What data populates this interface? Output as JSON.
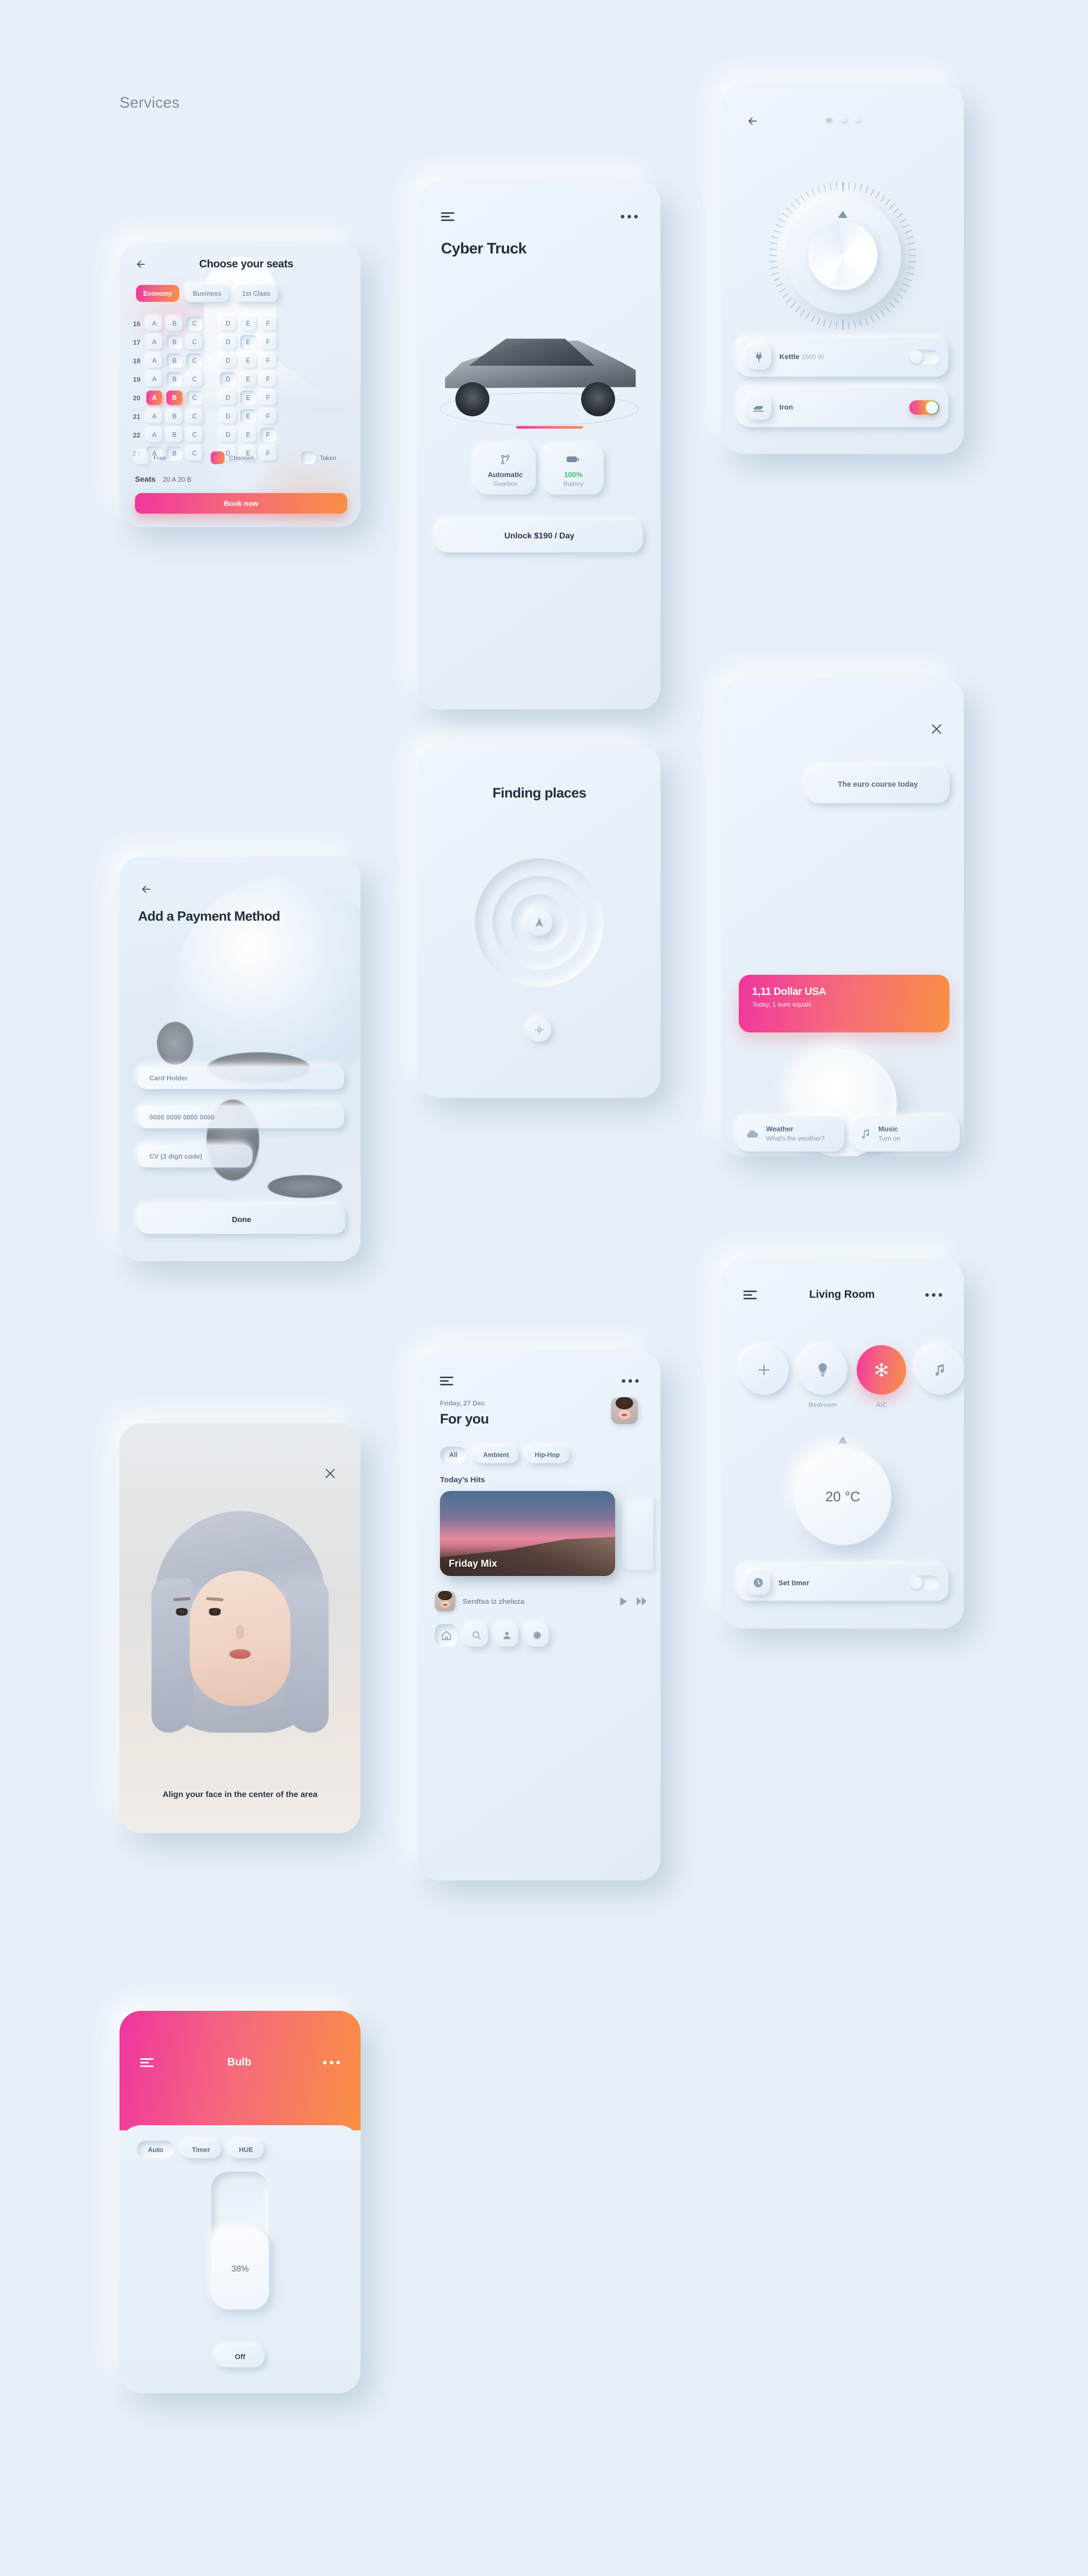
{
  "page": {
    "title": "Services",
    "background": "#e8f1fa",
    "accent_start": "#f0359f",
    "accent_end": "#f99143"
  },
  "seats_card": {
    "title": "Choose your seats",
    "classes": [
      {
        "label": "Economy",
        "active": true
      },
      {
        "label": "Business",
        "active": false
      },
      {
        "label": "1st Class",
        "active": false
      }
    ],
    "columns": [
      "A",
      "B",
      "C",
      "D",
      "E",
      "F"
    ],
    "rows": [
      {
        "number": "16",
        "seats": [
          {
            "label": "A",
            "state": "free"
          },
          {
            "label": "B",
            "state": "free"
          },
          {
            "label": "C",
            "state": "taken"
          },
          {
            "label": "D",
            "state": "free"
          },
          {
            "label": "E",
            "state": "free"
          },
          {
            "label": "F",
            "state": "free"
          }
        ]
      },
      {
        "number": "17",
        "seats": [
          {
            "label": "A",
            "state": "free"
          },
          {
            "label": "B",
            "state": "taken"
          },
          {
            "label": "C",
            "state": "free"
          },
          {
            "label": "D",
            "state": "free"
          },
          {
            "label": "E",
            "state": "taken"
          },
          {
            "label": "F",
            "state": "free"
          }
        ]
      },
      {
        "number": "18",
        "seats": [
          {
            "label": "A",
            "state": "free"
          },
          {
            "label": "B",
            "state": "taken"
          },
          {
            "label": "C",
            "state": "taken"
          },
          {
            "label": "D",
            "state": "free"
          },
          {
            "label": "E",
            "state": "free"
          },
          {
            "label": "F",
            "state": "free"
          }
        ]
      },
      {
        "number": "19",
        "seats": [
          {
            "label": "A",
            "state": "free"
          },
          {
            "label": "B",
            "state": "taken"
          },
          {
            "label": "C",
            "state": "free"
          },
          {
            "label": "D",
            "state": "taken"
          },
          {
            "label": "E",
            "state": "free"
          },
          {
            "label": "F",
            "state": "free"
          }
        ]
      },
      {
        "number": "20",
        "seats": [
          {
            "label": "A",
            "state": "chosen"
          },
          {
            "label": "B",
            "state": "chosen"
          },
          {
            "label": "C",
            "state": "taken"
          },
          {
            "label": "D",
            "state": "free"
          },
          {
            "label": "E",
            "state": "taken"
          },
          {
            "label": "F",
            "state": "free"
          }
        ]
      },
      {
        "number": "21",
        "seats": [
          {
            "label": "A",
            "state": "free"
          },
          {
            "label": "B",
            "state": "free"
          },
          {
            "label": "C",
            "state": "free"
          },
          {
            "label": "D",
            "state": "free"
          },
          {
            "label": "E",
            "state": "taken"
          },
          {
            "label": "F",
            "state": "free"
          }
        ]
      },
      {
        "number": "22",
        "seats": [
          {
            "label": "A",
            "state": "free"
          },
          {
            "label": "B",
            "state": "free"
          },
          {
            "label": "C",
            "state": "free"
          },
          {
            "label": "D",
            "state": "free"
          },
          {
            "label": "E",
            "state": "free"
          },
          {
            "label": "F",
            "state": "taken"
          }
        ]
      },
      {
        "number": "23",
        "seats": [
          {
            "label": "A",
            "state": "taken"
          },
          {
            "label": "B",
            "state": "taken"
          },
          {
            "label": "C",
            "state": "free"
          },
          {
            "label": "D",
            "state": "free"
          },
          {
            "label": "E",
            "state": "free"
          },
          {
            "label": "F",
            "state": "free"
          }
        ]
      }
    ],
    "legend": [
      {
        "label": "Free",
        "state": "free"
      },
      {
        "label": "Choosen",
        "state": "chosen"
      },
      {
        "label": "Taken",
        "state": "taken"
      }
    ],
    "summary_label": "Seats",
    "summary_value": "20 A  20 B",
    "book_button": "Book now"
  },
  "truck_card": {
    "title": "Cyber Truck",
    "specs": [
      {
        "icon": "gearbox-icon",
        "value": "Automatic",
        "sub": "Gearbox",
        "value_color": "#4a5768"
      },
      {
        "icon": "battery-icon",
        "value": "100%",
        "sub": "Battery",
        "value_color": "#38c172"
      }
    ],
    "unlock_button": "Unlock $190 / Day"
  },
  "places_card": {
    "title": "Finding places"
  },
  "music_card": {
    "date": "Friday, 27 Dec",
    "title": "For you",
    "genres": [
      {
        "label": "All",
        "active": true
      },
      {
        "label": "Ambient",
        "active": false
      },
      {
        "label": "Hip-Hop",
        "active": false
      }
    ],
    "section_label": "Today's Hits",
    "featured": {
      "name": "Friday Mix"
    },
    "now_playing": {
      "title": "Serdtsa iz zheleza"
    },
    "nav": [
      {
        "icon": "home-icon",
        "active": true
      },
      {
        "icon": "search-icon",
        "active": false
      },
      {
        "icon": "profile-icon",
        "active": false
      },
      {
        "icon": "gear-icon",
        "active": false
      }
    ]
  },
  "payment_card": {
    "title": "Add a Payment Method",
    "fields": [
      {
        "name": "card-holder",
        "placeholder": "Card Holder"
      },
      {
        "name": "card-number",
        "placeholder": "0000 0000 0000 0000"
      },
      {
        "name": "cv-code",
        "placeholder": "CV (3 digit code)"
      }
    ],
    "done_button": "Done"
  },
  "face_card": {
    "caption": "Align your face in the center of the area"
  },
  "bulb_card": {
    "title": "Bulb",
    "modes": [
      {
        "label": "Auto",
        "active": true
      },
      {
        "label": "Timer",
        "active": false
      },
      {
        "label": "HUE",
        "active": false
      }
    ],
    "brightness": "38%",
    "power_button": "Off"
  },
  "dial_card": {
    "devices": [
      {
        "icon": "plug-icon",
        "name": "Kettle",
        "sub": "1500 W",
        "toggle": "off"
      },
      {
        "icon": "iron-icon",
        "name": "Iron",
        "sub": "",
        "toggle": "rainbow"
      }
    ]
  },
  "voice_card": {
    "bubble": "The euro course today",
    "answer": {
      "title": "1,11 Dollar USA",
      "sub": "Today, 1 euro equals"
    },
    "chips": [
      {
        "icon": "cloud-icon",
        "name": "Weather",
        "sub": "What's the weather?"
      },
      {
        "icon": "music-note-icon",
        "name": "Music",
        "sub": "Turn on"
      }
    ]
  },
  "living_card": {
    "title": "Living Room",
    "actions": [
      {
        "icon": "plus-icon",
        "label": "",
        "active": false
      },
      {
        "icon": "bulb-icon",
        "label": "Bedroom",
        "active": false
      },
      {
        "icon": "snowflake-icon",
        "label": "AIC",
        "active": true
      },
      {
        "icon": "music-note-icon",
        "label": "",
        "active": false
      }
    ],
    "temperature": "20 °C",
    "timer_label": "Set timer",
    "timer_toggle": "off"
  }
}
